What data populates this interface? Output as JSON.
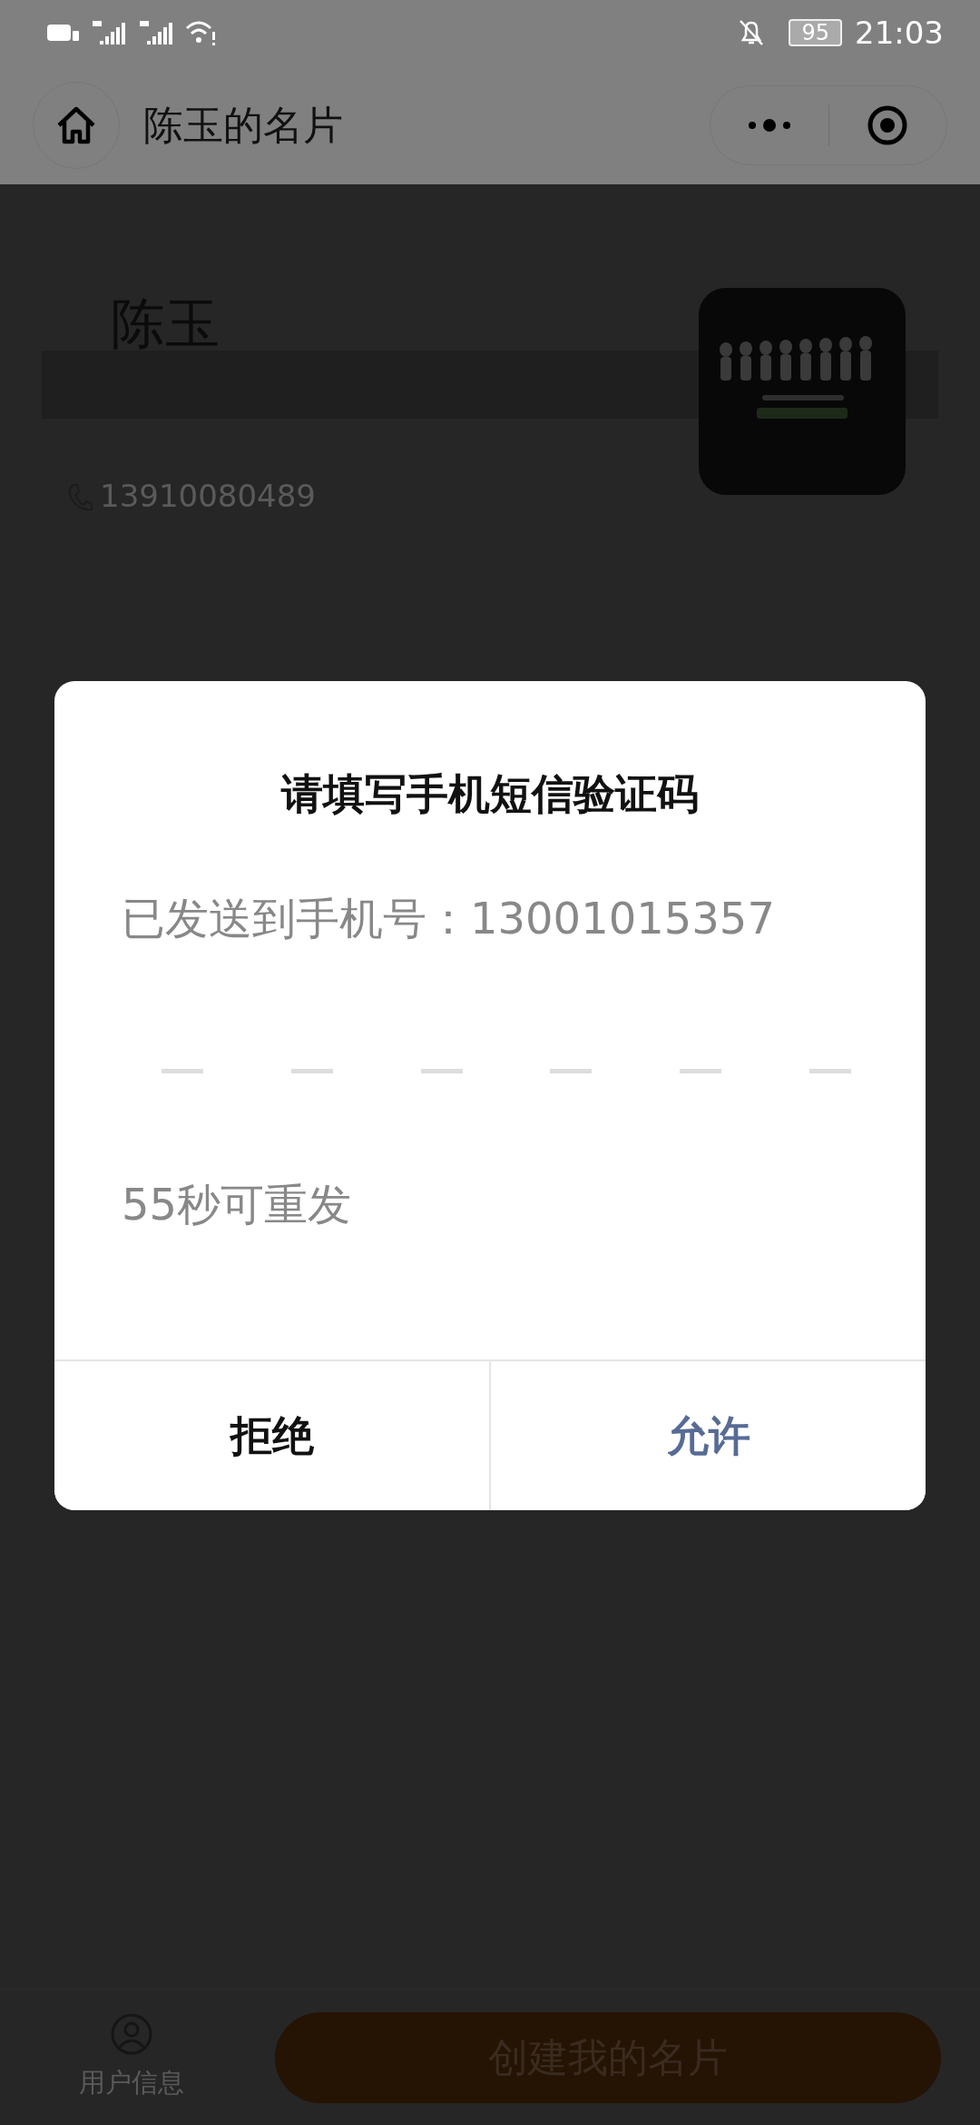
{
  "status_bar": {
    "battery": "95",
    "time": "21:03"
  },
  "nav": {
    "title": "陈玉的名片"
  },
  "card": {
    "name": "陈玉",
    "phone": "13910080489"
  },
  "dialog": {
    "title": "请填写手机短信验证码",
    "sent_to": "已发送到手机号：13001015357",
    "countdown": "55秒可重发",
    "buttons": [
      {
        "label": "拒绝",
        "kind": "cancel"
      },
      {
        "label": "允许",
        "kind": "confirm"
      }
    ]
  },
  "bottom_bar": {
    "tab_label": "用户信息",
    "create_button": "创建我的名片"
  }
}
